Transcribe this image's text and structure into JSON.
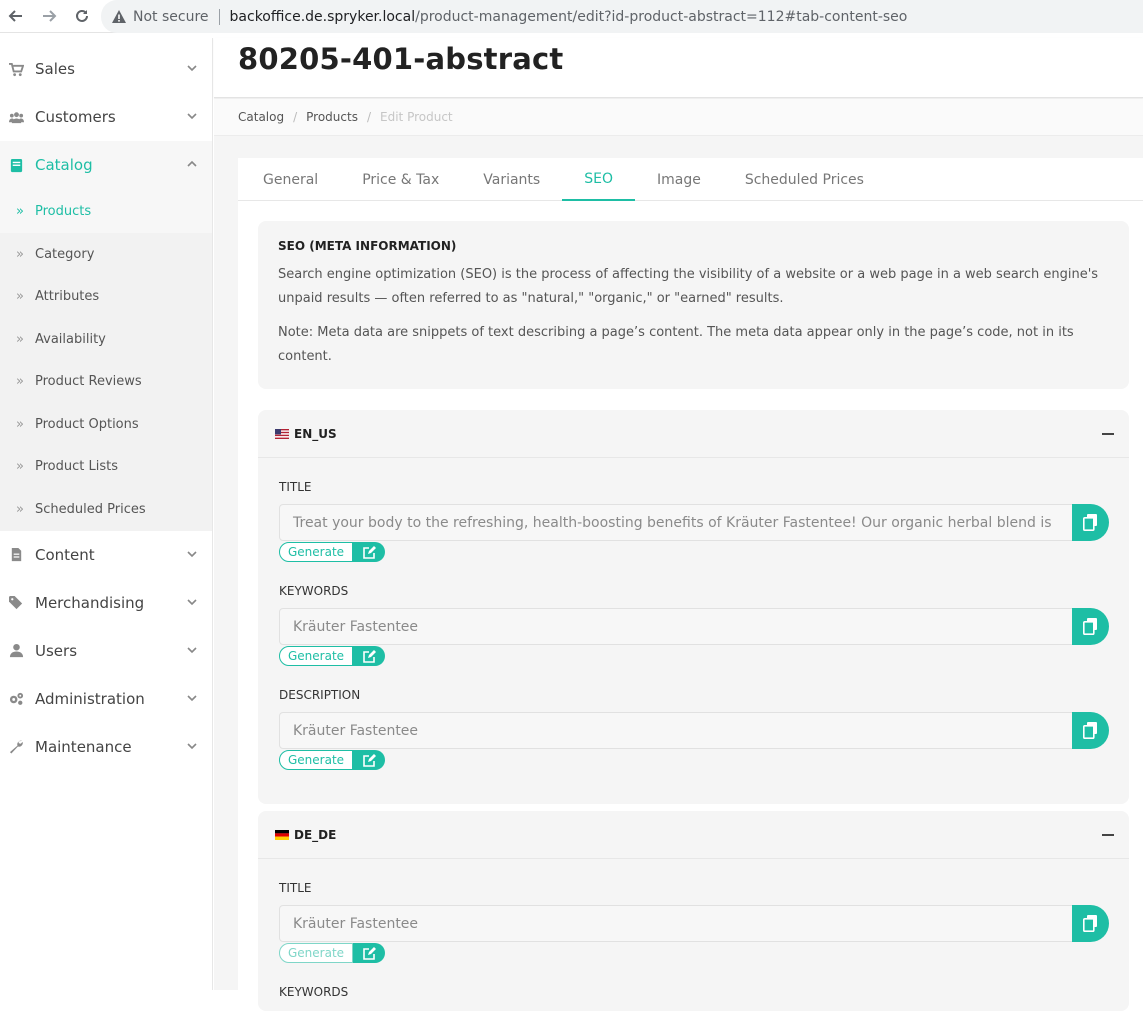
{
  "browser": {
    "not_secure": "Not secure",
    "host": "backoffice.de.spryker.local",
    "path": "/product-management/edit?id-product-abstract=112#tab-content-seo"
  },
  "sidebar": {
    "items": [
      {
        "label": "Sales",
        "icon": "cart-icon"
      },
      {
        "label": "Customers",
        "icon": "users-icon"
      },
      {
        "label": "Catalog",
        "icon": "book-icon",
        "expanded": true
      },
      {
        "label": "Content",
        "icon": "file-icon"
      },
      {
        "label": "Merchandising",
        "icon": "tags-icon"
      },
      {
        "label": "Users",
        "icon": "user-icon"
      },
      {
        "label": "Administration",
        "icon": "cogs-icon"
      },
      {
        "label": "Maintenance",
        "icon": "wrench-icon"
      }
    ],
    "catalog_sub": [
      "Products",
      "Category",
      "Attributes",
      "Availability",
      "Product Reviews",
      "Product Options",
      "Product Lists",
      "Scheduled Prices"
    ],
    "active_sub": "Products"
  },
  "page": {
    "title": "80205-401-abstract",
    "breadcrumb": [
      "Catalog",
      "Products",
      "Edit Product"
    ]
  },
  "tabs": [
    "General",
    "Price & Tax",
    "Variants",
    "SEO",
    "Image",
    "Scheduled Prices"
  ],
  "active_tab": "SEO",
  "info": {
    "title": "SEO (META INFORMATION)",
    "text1": "Search engine optimization (SEO) is the process of affecting the visibility of a website or a web page in a web search engine's unpaid results — often referred to as \"natural,\" \"organic,\" or \"earned\" results.",
    "text2": "Note: Meta data are snippets of text describing a page’s content. The meta data appear only in the page’s code, not in its content."
  },
  "generate_label": "Generate",
  "locales": [
    {
      "code": "EN_US",
      "fields": [
        {
          "label": "TITLE",
          "value": "Treat your body to the refreshing, health-boosting benefits of Kräuter Fastentee! Our organic herbal blend is"
        },
        {
          "label": "KEYWORDS",
          "value": "Kräuter Fastentee"
        },
        {
          "label": "DESCRIPTION",
          "value": "Kräuter Fastentee"
        }
      ]
    },
    {
      "code": "DE_DE",
      "fields": [
        {
          "label": "TITLE",
          "value": "Kräuter Fastentee"
        },
        {
          "label": "KEYWORDS",
          "value": ""
        }
      ]
    }
  ],
  "colors": {
    "accent": "#1ebea5"
  }
}
